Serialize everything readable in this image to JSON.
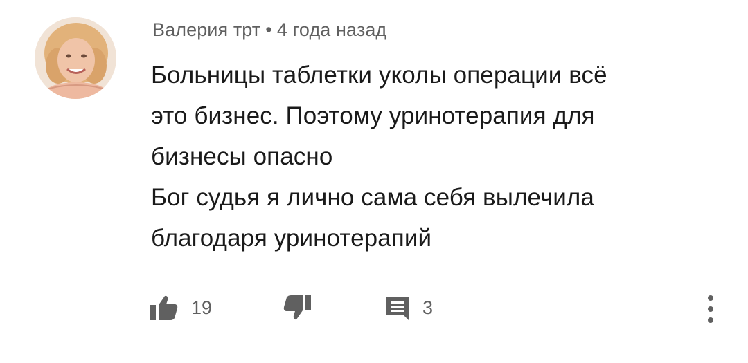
{
  "comment": {
    "author": "Валерия трт",
    "separator": "•",
    "time": "4 года назад",
    "lines": [
      "Больницы таблетки уколы операции всё",
      "это бизнес. Поэтому уринотерапия для",
      "бизнесы опасно",
      "Бог судья я лично сама себя вылечила",
      "благодаря уринотерапий"
    ]
  },
  "actions": {
    "like_count": "19",
    "reply_count": "3",
    "icons": {
      "like": "thumbs-up-icon",
      "dislike": "thumbs-down-icon",
      "reply": "comment-icon",
      "more": "more-vert-icon"
    }
  },
  "colors": {
    "text": "#1a1a1a",
    "secondary": "#606060",
    "icon": "#606060"
  }
}
